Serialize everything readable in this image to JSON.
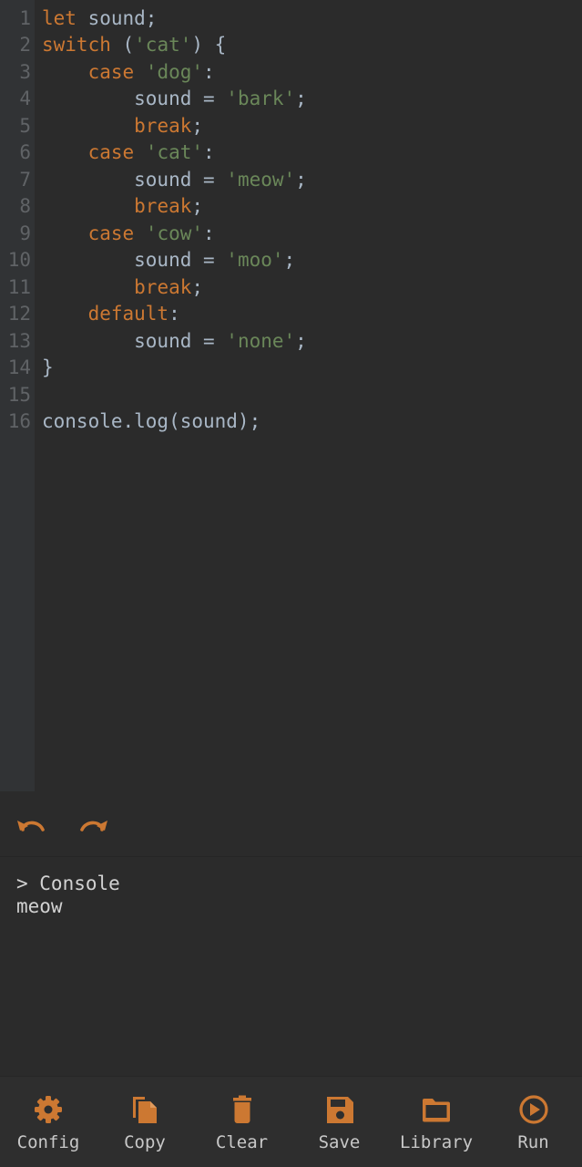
{
  "colors": {
    "background": "#2b2b2b",
    "gutter": "#313335",
    "line_number": "#606366",
    "text": "#a9b7c6",
    "keyword": "#cc7832",
    "string": "#6a8759",
    "accent": "#cc7832",
    "toolbar_label": "#c8c8c8"
  },
  "editor": {
    "line_numbers": [
      "1",
      "2",
      "3",
      "4",
      "5",
      "6",
      "7",
      "8",
      "9",
      "10",
      "11",
      "12",
      "13",
      "14",
      "15",
      "16"
    ],
    "lines": [
      [
        {
          "t": "let",
          "c": "kw"
        },
        {
          "t": " sound;",
          "c": "tx"
        }
      ],
      [
        {
          "t": "switch",
          "c": "kw"
        },
        {
          "t": " (",
          "c": "tx"
        },
        {
          "t": "'cat'",
          "c": "str"
        },
        {
          "t": ") {",
          "c": "tx"
        }
      ],
      [
        {
          "t": "    ",
          "c": "tx"
        },
        {
          "t": "case",
          "c": "kw"
        },
        {
          "t": " ",
          "c": "tx"
        },
        {
          "t": "'dog'",
          "c": "str"
        },
        {
          "t": ":",
          "c": "tx"
        }
      ],
      [
        {
          "t": "        sound = ",
          "c": "tx"
        },
        {
          "t": "'bark'",
          "c": "str"
        },
        {
          "t": ";",
          "c": "tx"
        }
      ],
      [
        {
          "t": "        ",
          "c": "tx"
        },
        {
          "t": "break",
          "c": "kw"
        },
        {
          "t": ";",
          "c": "tx"
        }
      ],
      [
        {
          "t": "    ",
          "c": "tx"
        },
        {
          "t": "case",
          "c": "kw"
        },
        {
          "t": " ",
          "c": "tx"
        },
        {
          "t": "'cat'",
          "c": "str"
        },
        {
          "t": ":",
          "c": "tx"
        }
      ],
      [
        {
          "t": "        sound = ",
          "c": "tx"
        },
        {
          "t": "'meow'",
          "c": "str"
        },
        {
          "t": ";",
          "c": "tx"
        }
      ],
      [
        {
          "t": "        ",
          "c": "tx"
        },
        {
          "t": "break",
          "c": "kw"
        },
        {
          "t": ";",
          "c": "tx"
        }
      ],
      [
        {
          "t": "    ",
          "c": "tx"
        },
        {
          "t": "case",
          "c": "kw"
        },
        {
          "t": " ",
          "c": "tx"
        },
        {
          "t": "'cow'",
          "c": "str"
        },
        {
          "t": ":",
          "c": "tx"
        }
      ],
      [
        {
          "t": "        sound = ",
          "c": "tx"
        },
        {
          "t": "'moo'",
          "c": "str"
        },
        {
          "t": ";",
          "c": "tx"
        }
      ],
      [
        {
          "t": "        ",
          "c": "tx"
        },
        {
          "t": "break",
          "c": "kw"
        },
        {
          "t": ";",
          "c": "tx"
        }
      ],
      [
        {
          "t": "    ",
          "c": "tx"
        },
        {
          "t": "default",
          "c": "kw"
        },
        {
          "t": ":",
          "c": "tx"
        }
      ],
      [
        {
          "t": "        sound = ",
          "c": "tx"
        },
        {
          "t": "'none'",
          "c": "str"
        },
        {
          "t": ";",
          "c": "tx"
        }
      ],
      [
        {
          "t": "}",
          "c": "tx"
        }
      ],
      [],
      [
        {
          "t": "console.log(sound);",
          "c": "tx"
        }
      ]
    ]
  },
  "history": {
    "undo_icon": "undo-icon",
    "redo_icon": "redo-icon"
  },
  "console": {
    "title": "> Console",
    "output": "meow"
  },
  "toolbar": {
    "items": [
      {
        "label": "Config",
        "icon": "gear-icon"
      },
      {
        "label": "Copy",
        "icon": "copy-icon"
      },
      {
        "label": "Clear",
        "icon": "trash-icon"
      },
      {
        "label": "Save",
        "icon": "floppy-icon"
      },
      {
        "label": "Library",
        "icon": "folder-icon"
      },
      {
        "label": "Run",
        "icon": "play-circle-icon"
      }
    ]
  }
}
